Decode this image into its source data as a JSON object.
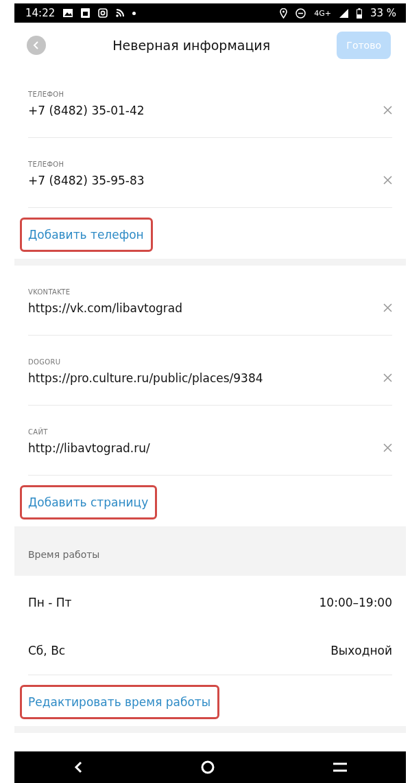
{
  "status_bar": {
    "time": "14:22",
    "network": "4G+",
    "battery": "33 %"
  },
  "header": {
    "title": "Неверная информация",
    "done_button": {
      "label": "Готово",
      "disabled": true
    }
  },
  "sections": [
    {
      "kind": "fields",
      "fields": [
        {
          "label": "ТЕЛЕФОН",
          "value": "+7 (8482) 35-01-42"
        },
        {
          "label": "ТЕЛЕФОН",
          "value": "+7 (8482) 35-95-83"
        }
      ],
      "action": {
        "label": "Добавить телефон",
        "highlighted": true
      }
    },
    {
      "kind": "fields",
      "fields": [
        {
          "label": "VKONTAKTE",
          "value": "https://vk.com/libavtograd"
        },
        {
          "label": "DOGORU",
          "value": "https://pro.culture.ru/public/places/9384"
        },
        {
          "label": "САЙТ",
          "value": "http://libavtograd.ru/"
        }
      ],
      "action": {
        "label": "Добавить страницу",
        "highlighted": true
      }
    },
    {
      "kind": "hours",
      "title": "Время работы",
      "rows": [
        {
          "days": "Пн - Пт",
          "time": "10:00–19:00"
        },
        {
          "days": "Сб, Вс",
          "time": "Выходной"
        }
      ],
      "action": {
        "label": "Редактировать время работы",
        "highlighted": true
      }
    }
  ]
}
